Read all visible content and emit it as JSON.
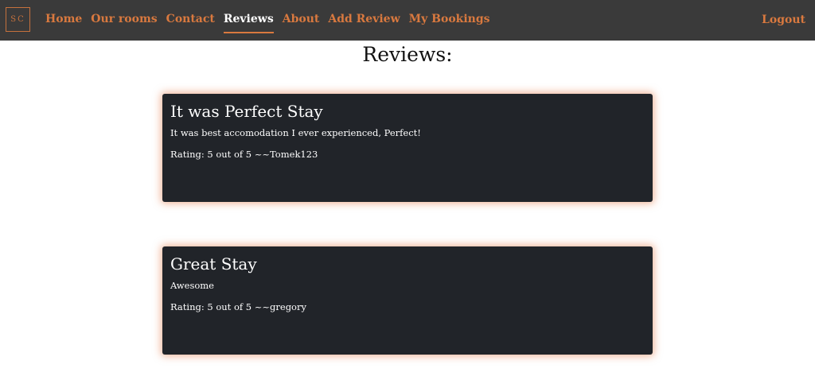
{
  "header": {
    "logo_text": "SC",
    "nav": [
      {
        "label": "Home"
      },
      {
        "label": "Our rooms"
      },
      {
        "label": "Contact"
      },
      {
        "label": "Reviews"
      },
      {
        "label": "About"
      },
      {
        "label": "Add Review"
      },
      {
        "label": "My Bookings"
      }
    ],
    "active_nav": "Reviews",
    "logout_label": "Logout"
  },
  "main": {
    "title": "Reviews:",
    "reviews": [
      {
        "title": "It was Perfect Stay",
        "text": "It was best accomodation I ever experienced, Perfect!",
        "rating_line": "Rating: 5 out of 5 ~~Tomek123"
      },
      {
        "title": "Great Stay",
        "text": "Awesome",
        "rating_line": "Rating: 5 out of 5 ~~gregory"
      }
    ]
  },
  "colors": {
    "navbar_bg": "#3a3a3a",
    "accent": "#d9793f",
    "card_bg": "#212429"
  }
}
